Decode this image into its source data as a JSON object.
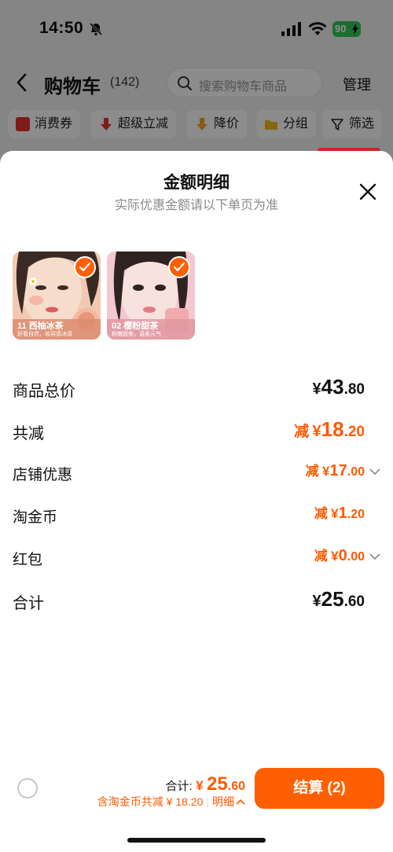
{
  "status_bar": {
    "time": "14:50",
    "battery": "90"
  },
  "nav": {
    "title": "购物车",
    "count": "(142)",
    "search_placeholder": "搜索购物车商品",
    "manage": "管理"
  },
  "filters": [
    {
      "label": "消费券",
      "icon": "coupon-icon",
      "color": "#e8322f"
    },
    {
      "label": "超级立减",
      "icon": "down-arrow-icon",
      "color": "#e8322f"
    },
    {
      "label": "降价",
      "icon": "price-drop-icon",
      "color": "#f5a623"
    },
    {
      "label": "分组",
      "icon": "folder-icon",
      "color": "#f5b81c"
    },
    {
      "label": "筛选",
      "icon": "filter-icon",
      "color": "#222222"
    }
  ],
  "sheet": {
    "title": "金额明细",
    "subtitle": "实际优惠金额请以下单页为准",
    "products": [
      {
        "caption": "11 西柚冰茶",
        "sub": "好看自然，妆容感冰感"
      },
      {
        "caption": "02 樱粉甜茶",
        "sub": "粉嫩甜美，温柔元气"
      }
    ],
    "rows": [
      {
        "label": "商品总价",
        "prefix": "",
        "yen": "¥",
        "int": "43",
        "dec": ".80"
      },
      {
        "label": "共减",
        "prefix": "减",
        "yen": "¥",
        "int": "18",
        "dec": ".20"
      },
      {
        "label": "店铺优惠",
        "prefix": "减",
        "yen": "¥",
        "int": "17",
        "dec": ".00"
      },
      {
        "label": "淘金币",
        "prefix": "减",
        "yen": "¥",
        "int": "1",
        "dec": ".20"
      },
      {
        "label": "红包",
        "prefix": "减",
        "yen": "¥",
        "int": "0",
        "dec": ".00"
      },
      {
        "label": "合计",
        "prefix": "",
        "yen": "¥",
        "int": "25",
        "dec": ".60"
      }
    ]
  },
  "bottom": {
    "total_label": "合计:",
    "total_yen": "¥",
    "total_int": "25",
    "total_dec": ".60",
    "saved_text": "含淘金币共减 ¥ 18.20",
    "detail_label": "明细",
    "checkout_label": "结算 (2)"
  },
  "colors": {
    "accent": "#ff5f00",
    "discount": "#ff5a00"
  }
}
